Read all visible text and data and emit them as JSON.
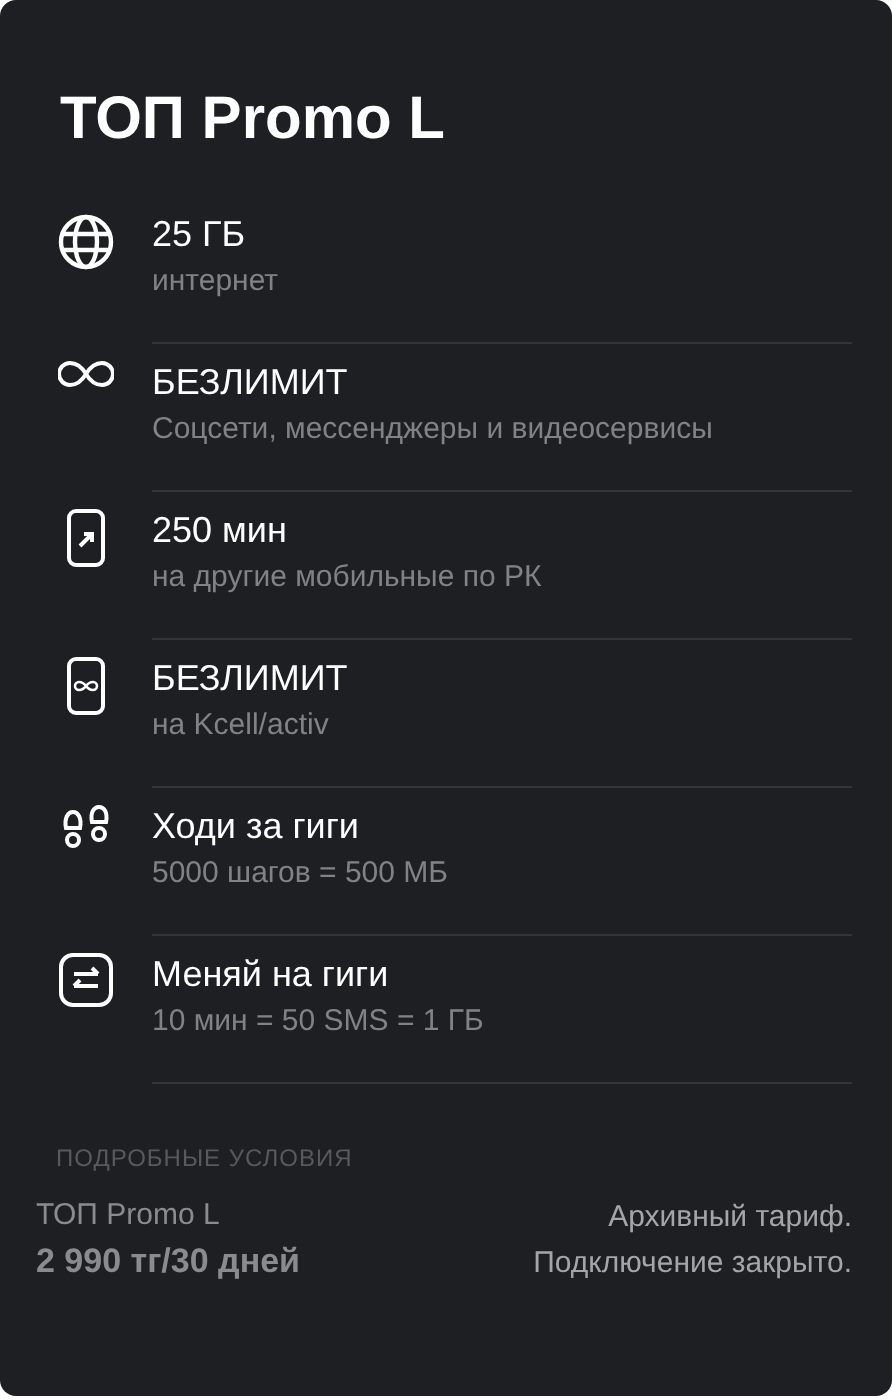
{
  "title": "ТОП Promo L",
  "features": [
    {
      "kind": "globe",
      "title": "25 ГБ",
      "subtitle": "интернет"
    },
    {
      "kind": "infinity",
      "title": "БЕЗЛИМИТ",
      "subtitle": "Соцсети, мессенджеры и видеосервисы"
    },
    {
      "kind": "phone-arrow",
      "title": "250 мин",
      "subtitle": "на другие мобильные по РК"
    },
    {
      "kind": "phone-infinity",
      "title": "БЕЗЛИМИТ",
      "subtitle": "на Kcell/activ"
    },
    {
      "kind": "steps",
      "title": "Ходи за гиги",
      "subtitle": "5000 шагов = 500 МБ"
    },
    {
      "kind": "exchange",
      "title": "Меняй на гиги",
      "subtitle": "10 мин = 50 SMS = 1 ГБ"
    }
  ],
  "details_link": "ПОДРОБНЫЕ УСЛОВИЯ",
  "footer": {
    "name": "ТОП Promo L",
    "price": "2 990 тг/30 дней",
    "status": [
      "Архивный тариф.",
      "Подключение закрыто."
    ]
  }
}
